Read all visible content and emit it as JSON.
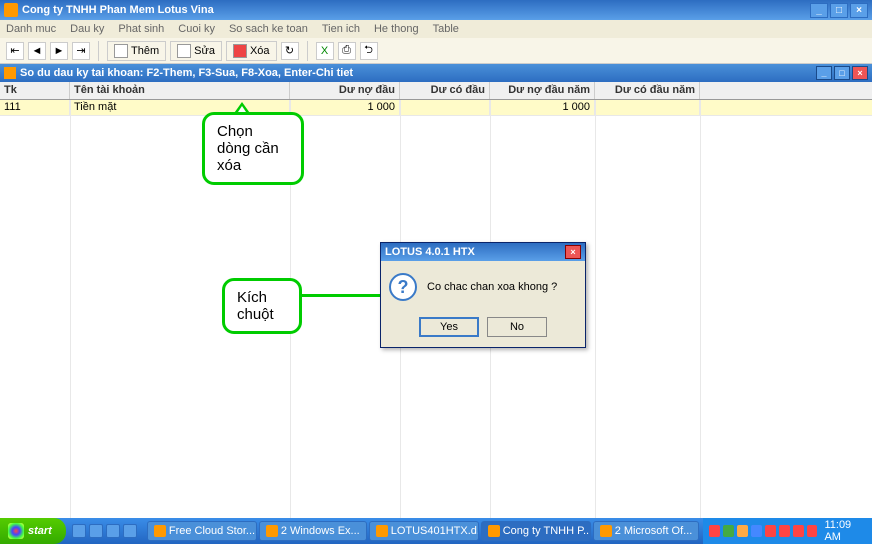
{
  "app": {
    "title": "Cong ty TNHH Phan Mem Lotus Vina"
  },
  "menu": {
    "items": [
      "Danh muc",
      "Dau ky",
      "Phat sinh",
      "Cuoi ky",
      "So sach ke toan",
      "Tien ich",
      "He thong",
      "Table"
    ]
  },
  "toolbar": {
    "them": "Thêm",
    "sua": "Sửa",
    "xoa": "Xóa"
  },
  "child": {
    "title": "So du dau ky tai khoan: F2-Them, F3-Sua, F8-Xoa, Enter-Chi tiet"
  },
  "columns": {
    "tk": "Tk",
    "ten": "Tên tài khoản",
    "dnd": "Dư nợ đầu",
    "dcd": "Dư có đầu",
    "dndn": "Dư nợ đầu năm",
    "dcdn": "Dư có đầu năm"
  },
  "rows": [
    {
      "tk": "111",
      "ten": "Tiền mặt",
      "dnd": "1 000",
      "dcd": "",
      "dndn": "1 000",
      "dcdn": ""
    }
  ],
  "dialog": {
    "title": "LOTUS 4.0.1 HTX",
    "msg": "Co chac chan xoa khong ?",
    "yes": "Yes",
    "no": "No"
  },
  "callouts": {
    "c1": "Chọn dòng cần xóa",
    "c2": "Kích chuột"
  },
  "taskbar": {
    "start": "start",
    "tasks": [
      "Free Cloud Stor...",
      "2 Windows Ex...",
      "LOTUS401HTX.d...",
      "Cong ty TNHH P...",
      "2 Microsoft Of..."
    ],
    "clock": "11:09 AM"
  }
}
